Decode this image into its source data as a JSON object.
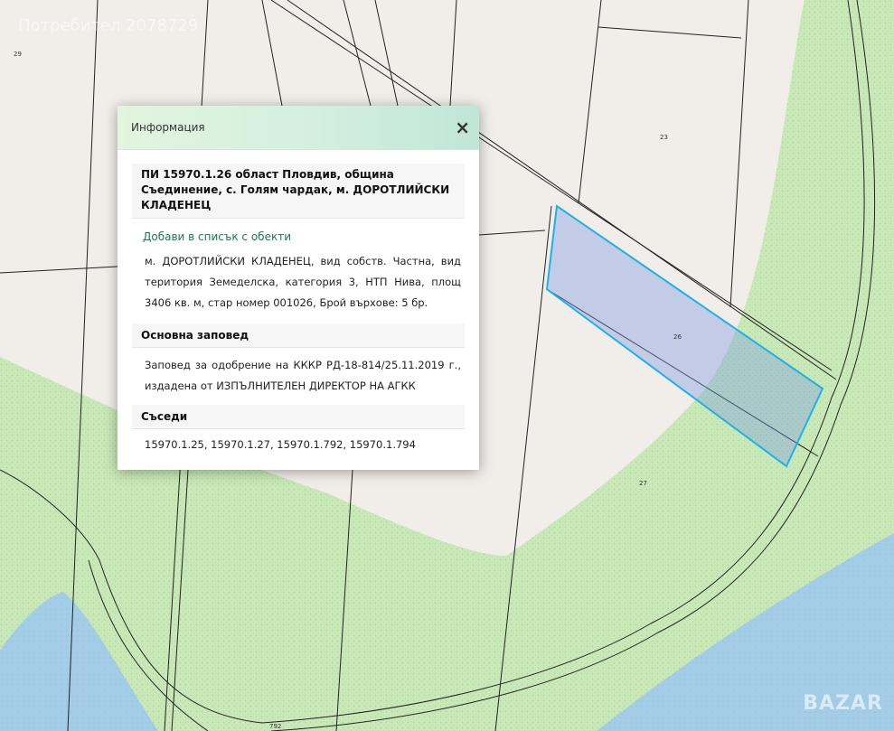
{
  "map": {
    "watermark": "Потребител 2078729",
    "brand": "BAZAR",
    "colors": {
      "land": "#f1eee9",
      "meadow": "#c9e8b8",
      "water": "#a3cce6",
      "selection": "#1fb1e6"
    },
    "parcel_labels": [
      "29",
      "23",
      "26",
      "27",
      "792"
    ]
  },
  "popup": {
    "title": "Информация",
    "close_label": "×",
    "parcel_title": "ПИ 15970.1.26 област Пловдив, община Съединение, с. Голям чардак, м. ДОРОТЛИЙСКИ КЛАДЕНЕЦ",
    "add_link": "Добави в списък с обекти",
    "description": "м. ДОРОТЛИЙСКИ КЛАДЕНЕЦ, вид собств. Частна, вид територия Земеделска, категория 3, НТП Нива, площ 3406 кв. м, стар номер 001026, Брой въpхове: 5 бр.",
    "order_header": "Основна заповед",
    "order_text": "Заповед за одобрение на КККР РД-18-814/25.11.2019 г., издадена от ИЗПЪЛНИТЕЛЕН ДИРЕКТОР НА АГКК",
    "neighbors_header": "Съседи",
    "neighbors": "15970.1.25, 15970.1.27, 15970.1.792, 15970.1.794"
  }
}
